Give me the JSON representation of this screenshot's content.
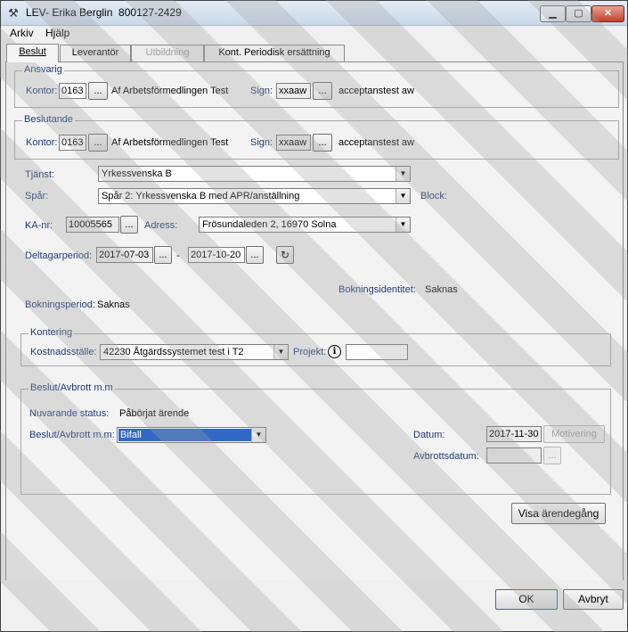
{
  "window": {
    "title": "LEV- Erika Berglin  800127-2429"
  },
  "menu": {
    "arkiv": "Arkiv",
    "hjalp": "Hjälp"
  },
  "tabs": [
    {
      "label": "Beslut"
    },
    {
      "label": "Leverantör"
    },
    {
      "label": "Utbildning"
    },
    {
      "label": "Kont. Periodisk ersättning"
    }
  ],
  "ansvarig": {
    "legend": "Ansvarig",
    "kontor_label": "Kontor:",
    "kontor_value": "0163",
    "kontor_name": "Af Arbetsförmedlingen Test",
    "sign_label": "Sign:",
    "sign_value": "xxaaw",
    "sign_name": "acceptanstest aw"
  },
  "beslutande": {
    "legend": "Beslutande",
    "kontor_label": "Kontor:",
    "kontor_value": "0163",
    "kontor_name": "Af Arbetsförmedlingen Test",
    "sign_label": "Sign:",
    "sign_value": "xxaaw",
    "sign_name": "acceptanstest aw"
  },
  "ellipsis": "...",
  "tjanst": {
    "label": "Tjänst:",
    "value": "Yrkessvenska B"
  },
  "spar": {
    "label": "Spår:",
    "value": "Spår 2: Yrkessvenska B med APR/anställning",
    "block_label": "Block:"
  },
  "ka": {
    "label": "KA-nr:",
    "value": "10005565"
  },
  "adress": {
    "label": "Adress:",
    "value": "Frösundaleden 2, 16970 Solna"
  },
  "deltagarperiod": {
    "label": "Deltagarperiod:",
    "from": "2017-07-03",
    "dash": "-",
    "to": "2017-10-20"
  },
  "bokningsidentitet": {
    "label": "Bokningsidentitet:",
    "value": "Saknas"
  },
  "bokningsperiod": {
    "label": "Bokningsperiod:",
    "value": "Saknas"
  },
  "kontering": {
    "legend": "Kontering",
    "kostnad_label": "Kostnadsställe:",
    "kostnad_value": "42230 Åtgärdssystemet test i T2",
    "projekt_label": "Projekt:",
    "projekt_value": ""
  },
  "beslut": {
    "legend": "Beslut/Avbrott m.m",
    "status_label": "Nuvarande status:",
    "status_value": "Påbörjat ärende",
    "beslut_label": "Beslut/Avbrott m.m:",
    "beslut_value": "Bifall",
    "datum_label": "Datum:",
    "datum_value": "2017-11-30",
    "motivering": "Motivering",
    "avbrott_label": "Avbrottsdatum:",
    "avbrott_value": ""
  },
  "visa": "Visa ärendegång",
  "ok": "OK",
  "avbryt": "Avbryt"
}
